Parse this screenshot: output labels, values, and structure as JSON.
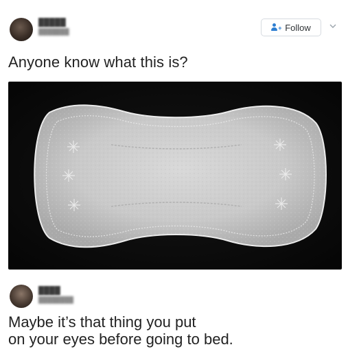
{
  "post": {
    "text": "Anyone know what this is?",
    "follow_label": "Follow",
    "image_description_icon": "pantyliner-photo"
  },
  "reply": {
    "lines": [
      "Maybe it’s that thing you put",
      "on your eyes before going to bed."
    ]
  },
  "colors": {
    "follow_icon": "#2f7fd1",
    "media_background": "#0b0b0b",
    "text": "#222222"
  }
}
